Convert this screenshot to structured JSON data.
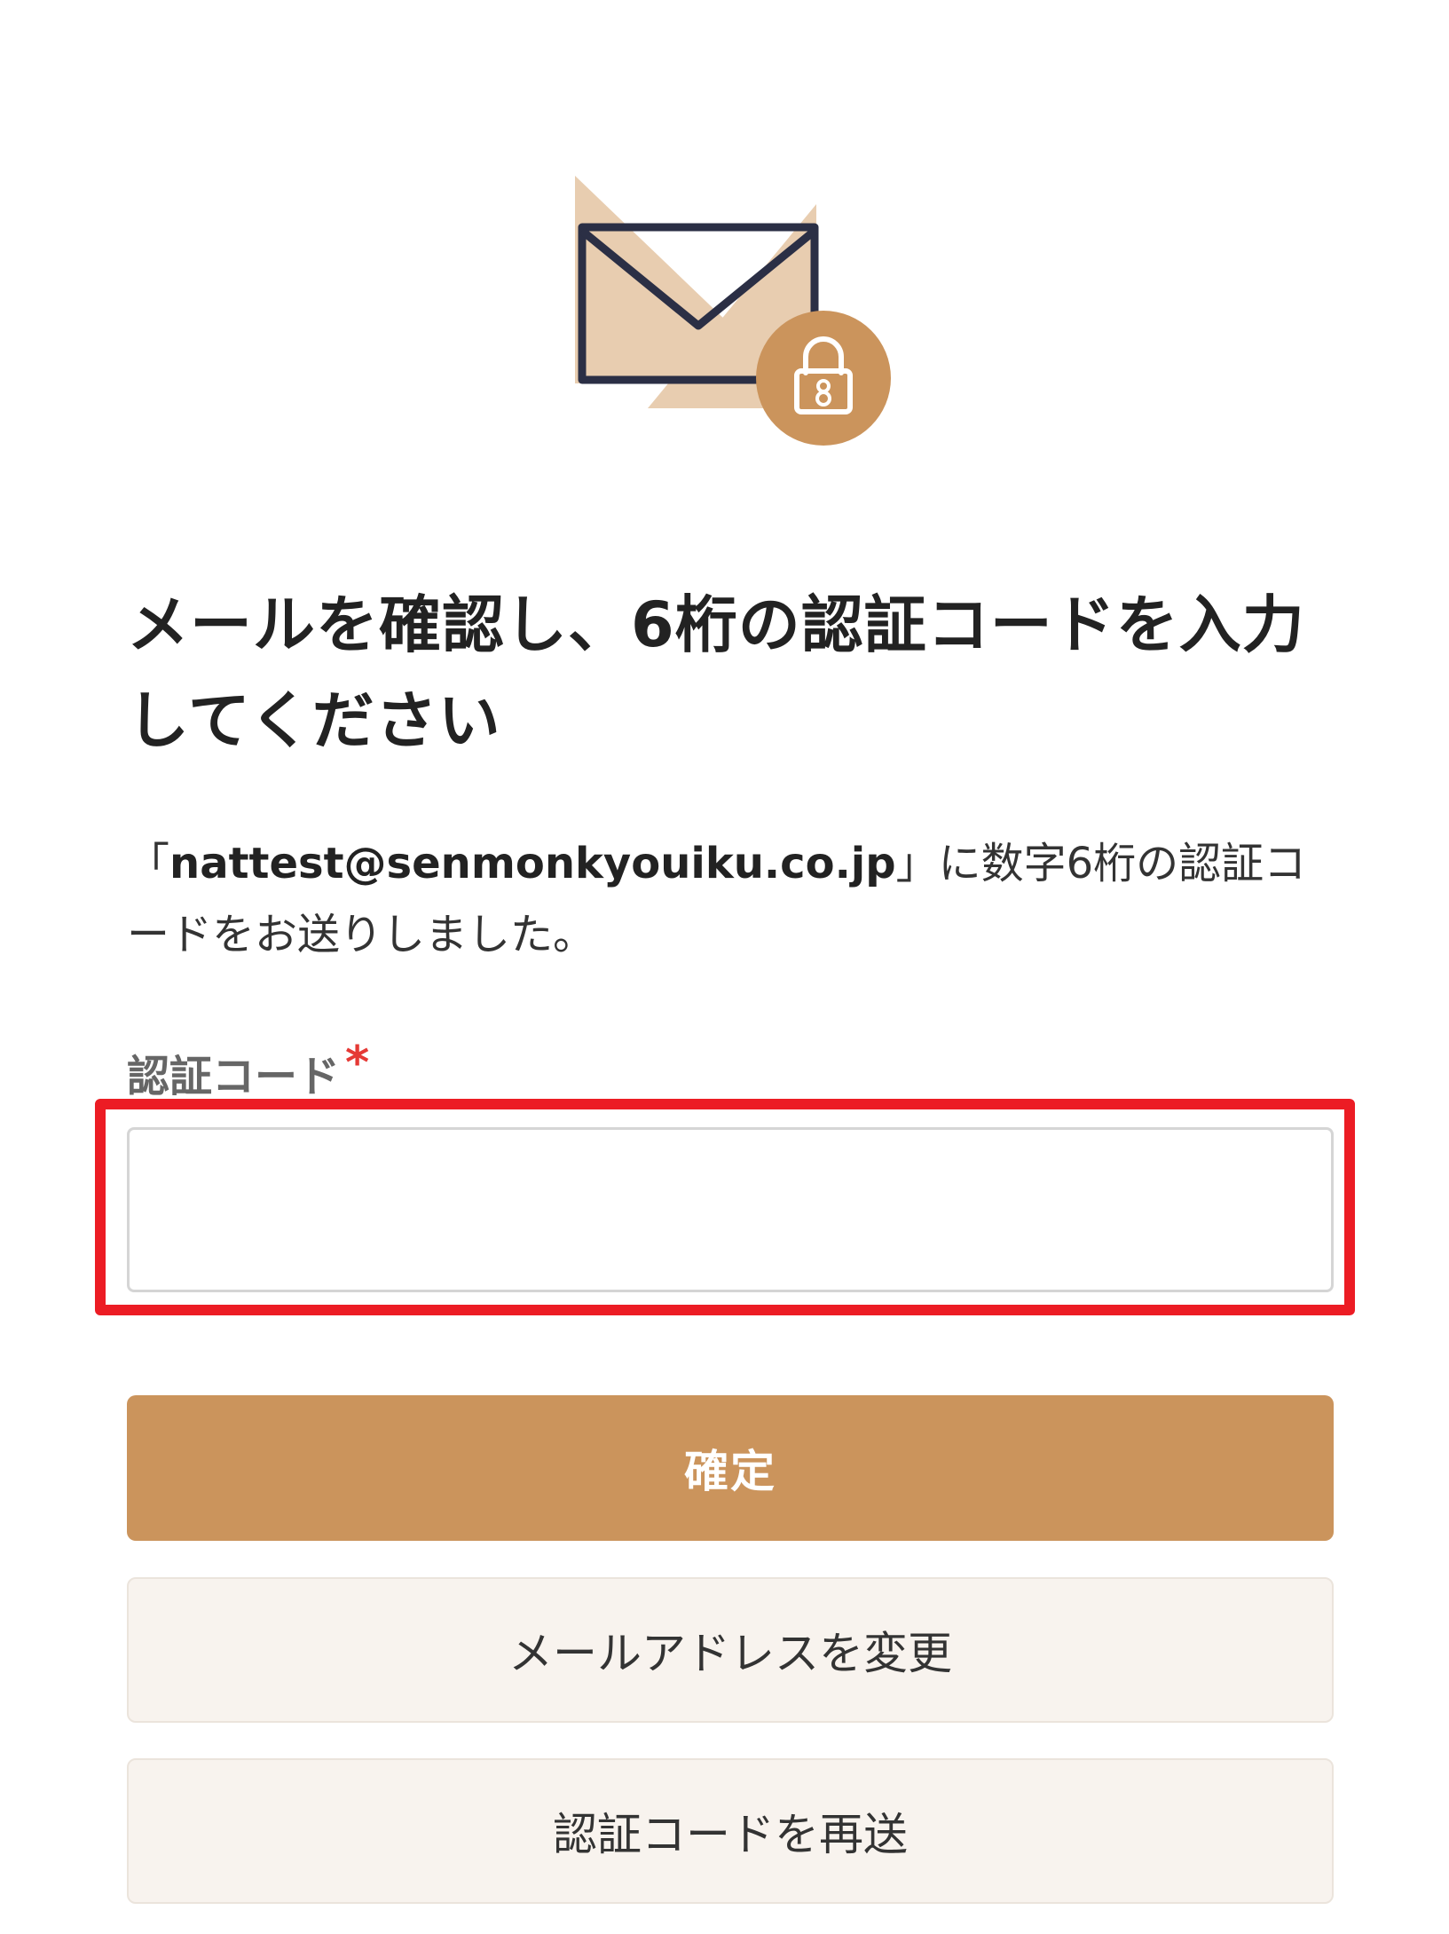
{
  "colors": {
    "accent": "#cb945c",
    "accent_light": "#e8cdb0",
    "envelope_stroke": "#2b2f45",
    "secondary_bg": "#f8f3ee",
    "required": "#e53935",
    "highlight": "#ec1c24"
  },
  "illustration": {
    "icons": [
      "envelope-icon",
      "lock-icon"
    ]
  },
  "heading": {
    "title": "メールを確認し、6桁の認証コードを入力してください"
  },
  "description": {
    "prefix": "「",
    "email": "nattest@senmonkyouiku.co.jp",
    "suffix": "」に数字6桁の認証コードをお送りしました。"
  },
  "form": {
    "code_label": "認証コード",
    "required_mark": "*",
    "code_value": "",
    "code_placeholder": ""
  },
  "buttons": {
    "confirm": "確定",
    "change_email": "メールアドレスを変更",
    "resend_code": "認証コードを再送"
  }
}
